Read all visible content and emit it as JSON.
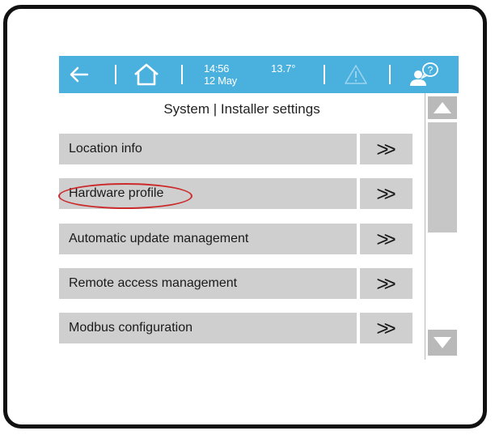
{
  "topbar": {
    "time": "14:56",
    "date": "12 May",
    "temperature": "13.7°",
    "colors": {
      "bar": "#4ab0de",
      "foreground": "#ffffff"
    },
    "icons": [
      "back-arrow-icon",
      "home-icon",
      "warning-icon",
      "user-help-icon"
    ]
  },
  "screen": {
    "title": "System | Installer settings"
  },
  "menu": {
    "arrow_glyph": ">>",
    "items": [
      {
        "label": "Location info"
      },
      {
        "label": "Hardware profile",
        "highlighted": true
      },
      {
        "label": "Automatic update management"
      },
      {
        "label": "Remote access management"
      },
      {
        "label": "Modbus configuration"
      }
    ]
  },
  "colors": {
    "highlight_ellipse": "#cc2a2a",
    "menu_background": "#cfcfcf"
  }
}
